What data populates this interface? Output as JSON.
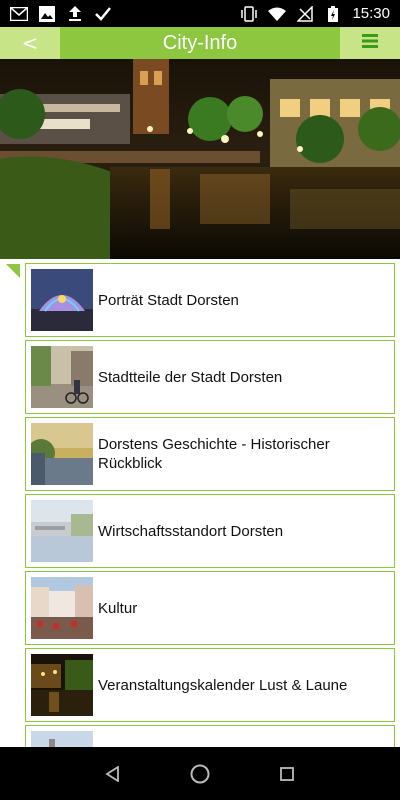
{
  "status_bar": {
    "time": "15:30",
    "left_icons": [
      "mail-icon",
      "image-icon",
      "upload-icon",
      "checkmark-icon"
    ],
    "right_icons": [
      "vibrate-icon",
      "wifi-icon",
      "no-signal-icon",
      "battery-charging-icon"
    ]
  },
  "app_bar": {
    "back_label": "<",
    "title": "City-Info",
    "menu_icon": "hamburger-menu-icon"
  },
  "hero": {
    "image": "dorsten-night-canal-photo"
  },
  "items": [
    {
      "label": "Porträt Stadt Dorsten",
      "thumb": "illuminated-dome-photo"
    },
    {
      "label": "Stadtteile der Stadt Dorsten",
      "thumb": "street-cyclist-photo"
    },
    {
      "label": "Dorstens Geschichte - Historischer Rückblick",
      "thumb": "river-view-photo"
    },
    {
      "label": "Wirtschaftsstandort Dorsten",
      "thumb": "waterfront-buildings-photo"
    },
    {
      "label": "Kultur",
      "thumb": "market-square-crowd-photo"
    },
    {
      "label": "Veranstaltungskalender Lust & Laune",
      "thumb": "night-event-photo"
    },
    {
      "label": "",
      "thumb": "partial-city-photo"
    }
  ],
  "colors": {
    "accent": "#8dc63f",
    "accent_light": "#c7e486"
  }
}
